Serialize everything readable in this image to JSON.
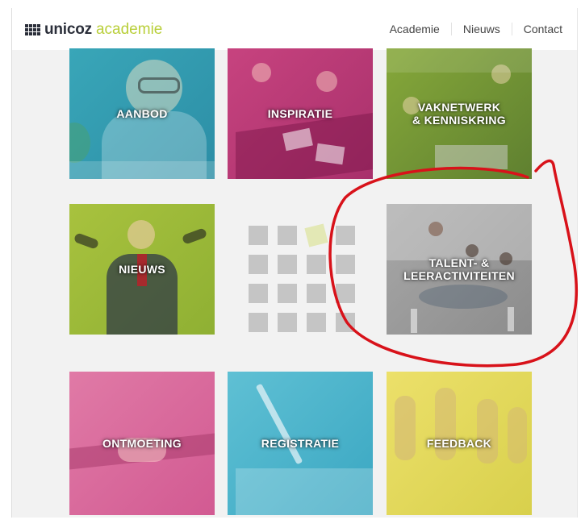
{
  "header": {
    "logo_brand": "unicoz",
    "logo_suffix": "academie",
    "nav": [
      "Academie",
      "Nieuws",
      "Contact"
    ]
  },
  "tiles": {
    "aanbod": "AANBOD",
    "inspiratie": "INSPIRATIE",
    "vaknetwerk": "VAKNETWERK\n& KENNISKRING",
    "nieuws": "NIEUWS",
    "talent": "TALENT- &\nLEERACTIVITEITEN",
    "ontmoeting": "ONTMOETING",
    "registratie": "REGISTRATIE",
    "feedback": "FEEDBACK"
  },
  "colors": {
    "brand_dark": "#2b2f3a",
    "brand_accent": "#b9cf3a",
    "annotation": "#d8121a"
  }
}
